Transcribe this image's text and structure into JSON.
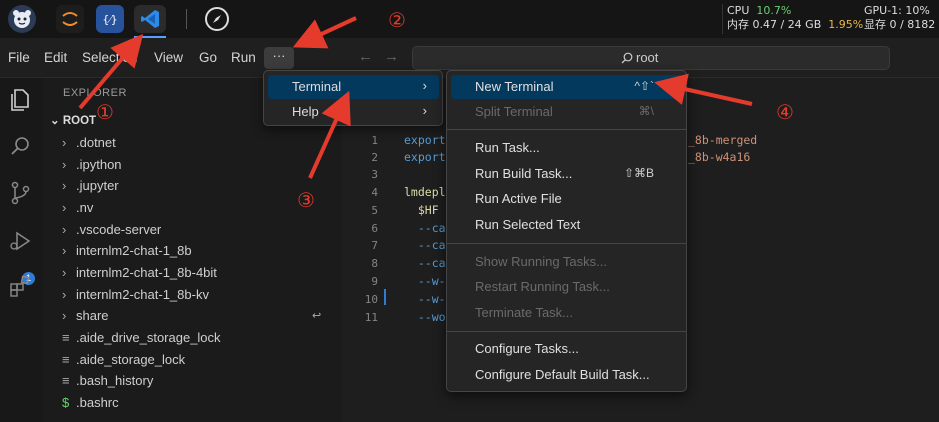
{
  "dock": {
    "code_icon_text": "{⁄}",
    "stats": {
      "cpu_label": "CPU",
      "cpu_value": "10.7%",
      "mem_label": "内存 0.47 / 24 GB",
      "mem_value": "1.95%",
      "gpu_label": "GPU-1: 10%",
      "vram_label": "显存 0 / 8182"
    }
  },
  "menubar": {
    "items": [
      "File",
      "Edit",
      "Selection",
      "View",
      "Go",
      "Run"
    ],
    "more": "···",
    "search": "root"
  },
  "activity": {
    "scm_badge": "1"
  },
  "explorer": {
    "title": "EXPLORER",
    "root": "ROOT",
    "items": [
      {
        "icon": "›",
        "name": ".dotnet"
      },
      {
        "icon": "›",
        "name": ".ipython"
      },
      {
        "icon": "›",
        "name": ".jupyter"
      },
      {
        "icon": "›",
        "name": ".nv"
      },
      {
        "icon": "›",
        "name": ".vscode-server"
      },
      {
        "icon": "›",
        "name": "internlm2-chat-1_8b"
      },
      {
        "icon": "›",
        "name": "internlm2-chat-1_8b-4bit"
      },
      {
        "icon": "›",
        "name": "internlm2-chat-1_8b-kv"
      },
      {
        "icon": "›",
        "name": "share"
      },
      {
        "icon": "≡",
        "name": ".aide_drive_storage_lock"
      },
      {
        "icon": "≡",
        "name": ".aide_storage_lock"
      },
      {
        "icon": "≡",
        "name": ".bash_history"
      },
      {
        "icon": "$",
        "name": ".bashrc"
      }
    ],
    "share_indicator": "↩"
  },
  "editor": {
    "lines": [
      {
        "no": "1",
        "code": "export",
        "tail": "_8b-merged"
      },
      {
        "no": "2",
        "code": "export",
        "tail": "_8b-w4a16"
      },
      {
        "no": "3",
        "code": "",
        "tail": ""
      },
      {
        "no": "4",
        "code": "lmdepl",
        "tail": ""
      },
      {
        "no": "5",
        "code": "  $HF",
        "tail": ""
      },
      {
        "no": "6",
        "code": "  --ca",
        "tail": ""
      },
      {
        "no": "7",
        "code": "  --ca",
        "tail": ""
      },
      {
        "no": "8",
        "code": "  --ca",
        "tail": ""
      },
      {
        "no": "9",
        "code": "  --w-",
        "tail": ""
      },
      {
        "no": "10",
        "code": "  --w-",
        "tail": ""
      },
      {
        "no": "11",
        "code": "  --wo",
        "tail": ""
      }
    ]
  },
  "more_menu": {
    "items": [
      {
        "label": "Terminal",
        "arrow": "›"
      },
      {
        "label": "Help",
        "arrow": "›"
      }
    ]
  },
  "terminal_menu": {
    "groups": [
      [
        {
          "label": "New Terminal",
          "key": "^⇧`",
          "disabled": false
        },
        {
          "label": "Split Terminal",
          "key": "⌘\\",
          "disabled": true
        }
      ],
      [
        {
          "label": "Run Task...",
          "key": "",
          "disabled": false
        },
        {
          "label": "Run Build Task...",
          "key": "⇧⌘B",
          "disabled": false
        },
        {
          "label": "Run Active File",
          "key": "",
          "disabled": false
        },
        {
          "label": "Run Selected Text",
          "key": "",
          "disabled": false
        }
      ],
      [
        {
          "label": "Show Running Tasks...",
          "key": "",
          "disabled": true
        },
        {
          "label": "Restart Running Task...",
          "key": "",
          "disabled": true
        },
        {
          "label": "Terminate Task...",
          "key": "",
          "disabled": true
        }
      ],
      [
        {
          "label": "Configure Tasks...",
          "key": "",
          "disabled": false
        },
        {
          "label": "Configure Default Build Task...",
          "key": "",
          "disabled": false
        }
      ]
    ]
  },
  "annotations": [
    "①",
    "②",
    "③",
    "④"
  ],
  "colors": {
    "accent": "#04395e",
    "arrow": "#e53b2c",
    "badge": "#2f7bd8"
  }
}
